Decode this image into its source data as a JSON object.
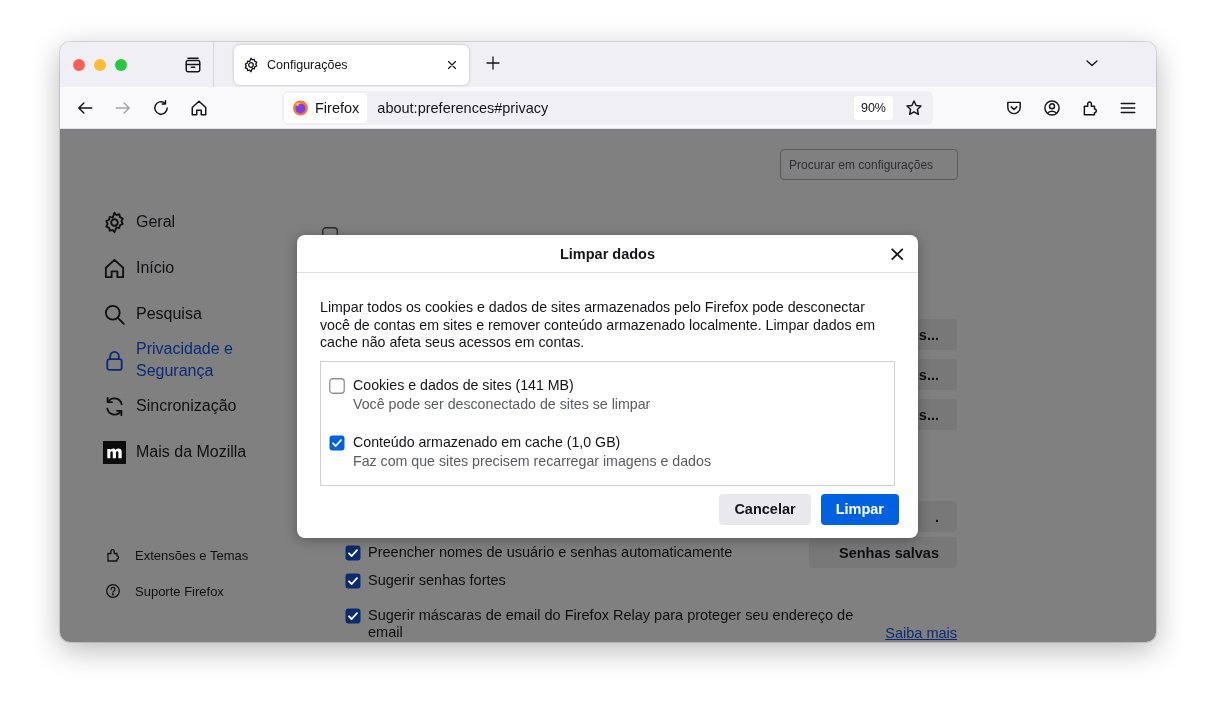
{
  "tabs": [
    {
      "label": "Configurações",
      "selected": true
    }
  ],
  "address_bar": {
    "identity": "Firefox",
    "url": "about:preferences#privacy",
    "zoom": "90%"
  },
  "search": {
    "placeholder": "Procurar em configurações"
  },
  "sidebar": {
    "items": [
      {
        "kind": "gear",
        "label": "Geral",
        "selected": false
      },
      {
        "kind": "home",
        "label": "Início",
        "selected": false
      },
      {
        "kind": "search",
        "label": "Pesquisa",
        "selected": false
      },
      {
        "kind": "lock",
        "label": "Privacidade e Segurança",
        "selected": true
      },
      {
        "kind": "sync",
        "label": "Sincronização",
        "selected": false
      },
      {
        "kind": "mozilla",
        "label": "Mais da Mozilla",
        "selected": false
      }
    ],
    "footer": [
      {
        "kind": "puzzle",
        "label": "Extensões e Temas"
      },
      {
        "kind": "help",
        "label": "Suporte Firefox"
      }
    ]
  },
  "main": {
    "rows": [
      {
        "checkbox": {
          "checked": false
        }
      },
      {
        "button": "s..."
      },
      {
        "button": "s..."
      },
      {
        "button": "s..."
      },
      {
        "button": "."
      },
      {
        "checkbox": {
          "label": "Preencher nomes de usuário e senhas automaticamente",
          "checked": true
        },
        "button": "Senhas salvas"
      },
      {
        "checkbox": {
          "label": "Sugerir senhas fortes",
          "checked": true
        }
      },
      {
        "checkbox": {
          "label": "Sugerir máscaras de email do Firefox Relay para proteger seu endereço de email",
          "checked": true
        },
        "side_link": "Saiba mais"
      }
    ]
  },
  "dialog": {
    "title": "Limpar dados",
    "close": "×",
    "message": "Limpar todos os cookies e dados de sites armazenados pelo Firefox pode desconectar você de contas em sites e remover conteúdo armazenado localmente. Limpar dados em cache não afeta seus acessos em contas.",
    "options": [
      {
        "label": "Cookies e dados de sites (141 MB)",
        "detail": "Você pode ser desconectado de sites se limpar",
        "checked": false
      },
      {
        "label": "Conteúdo armazenado em cache (1,0 GB)",
        "detail": "Faz com que sites precisem recarregar imagens e dados",
        "checked": true
      }
    ],
    "buttons": [
      {
        "label": "Cancelar",
        "kind": "secondary"
      },
      {
        "label": "Limpar",
        "kind": "primary"
      }
    ]
  }
}
